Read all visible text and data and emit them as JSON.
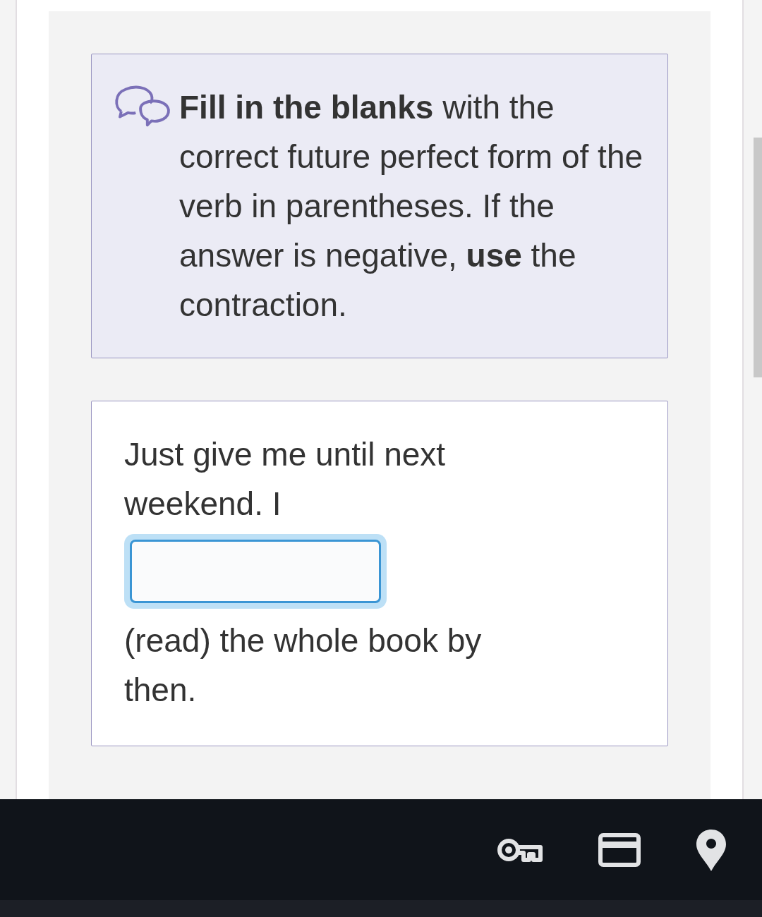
{
  "instructions": {
    "text": "**Fill in the blanks** with the correct future perfect form of the verb in parentheses. If the answer is negative, **use** the contraction."
  },
  "question": {
    "text_before": "Just give me until next weekend. I",
    "answer": {
      "focused": true
    },
    "text_after": "(read) the whole book by then."
  }
}
